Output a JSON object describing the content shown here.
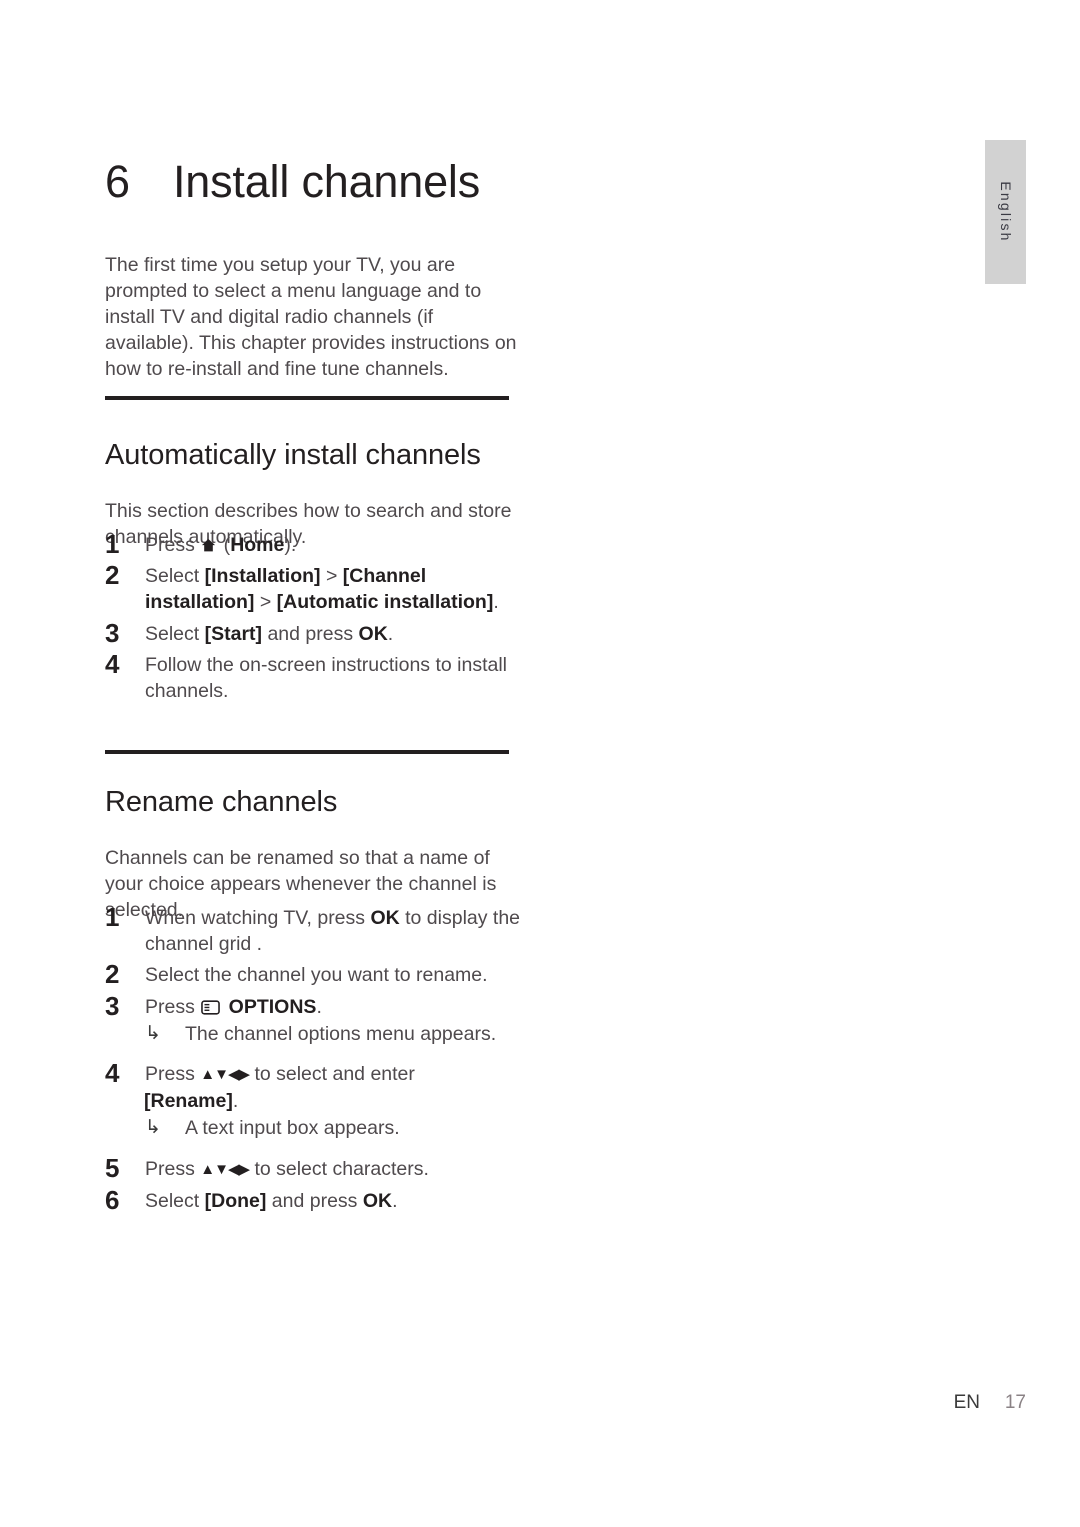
{
  "document": {
    "language_tab": "English",
    "footer": {
      "locale": "EN",
      "page_number": "17"
    }
  },
  "chapter": {
    "number": "6",
    "title": "Install channels",
    "intro": "The first time you setup your TV, you are prompted to select a menu language and to install TV and digital radio channels (if available). This chapter provides instructions on how to re-install and fine tune channels."
  },
  "sections": [
    {
      "title": "Automatically install channels",
      "intro": "This section describes how to search and store channels automatically.",
      "steps": [
        {
          "num": "1",
          "pre": "Press ",
          "icon": "home-icon",
          "post": " (",
          "bold": "Home",
          "tail": ")."
        },
        {
          "num": "2",
          "pre": "Select ",
          "bold": "[Installation]",
          "mid": " > ",
          "bold2": "[Channel installation]",
          "mid2": " > ",
          "bold3": "[Automatic installation]",
          "tail": "."
        },
        {
          "num": "3",
          "pre": "Select ",
          "bold": "[Start]",
          "mid": " and press ",
          "bold2": "OK",
          "tail": "."
        },
        {
          "num": "4",
          "pre": "Follow the on-screen instructions to install channels."
        }
      ]
    },
    {
      "title": "Rename channels",
      "intro": "Channels can be renamed so that a name of your choice appears whenever the channel is selected.",
      "steps": [
        {
          "num": "1",
          "pre": "When watching TV, press ",
          "bold": "OK",
          "tail": " to display the channel grid ."
        },
        {
          "num": "2",
          "pre": "Select the channel you want to rename."
        },
        {
          "num": "3",
          "pre": "Press ",
          "icon": "options-icon",
          "bold": " OPTIONS",
          "tail": ".",
          "result": "The channel options menu appears."
        },
        {
          "num": "4",
          "pre": "Press ",
          "arrows": "▲▼◀▶",
          "mid": " to select and enter",
          "bold_hang": "[Rename]",
          "tail": ".",
          "result": "A text input box appears."
        },
        {
          "num": "5",
          "pre": "Press ",
          "arrows": "▲▼◀▶",
          "mid": " to select characters."
        },
        {
          "num": "6",
          "pre": "Select ",
          "bold": "[Done]",
          "mid": " and press ",
          "bold2": "OK",
          "tail": "."
        }
      ]
    }
  ],
  "glyphs": {
    "result_arrow": "↳"
  }
}
